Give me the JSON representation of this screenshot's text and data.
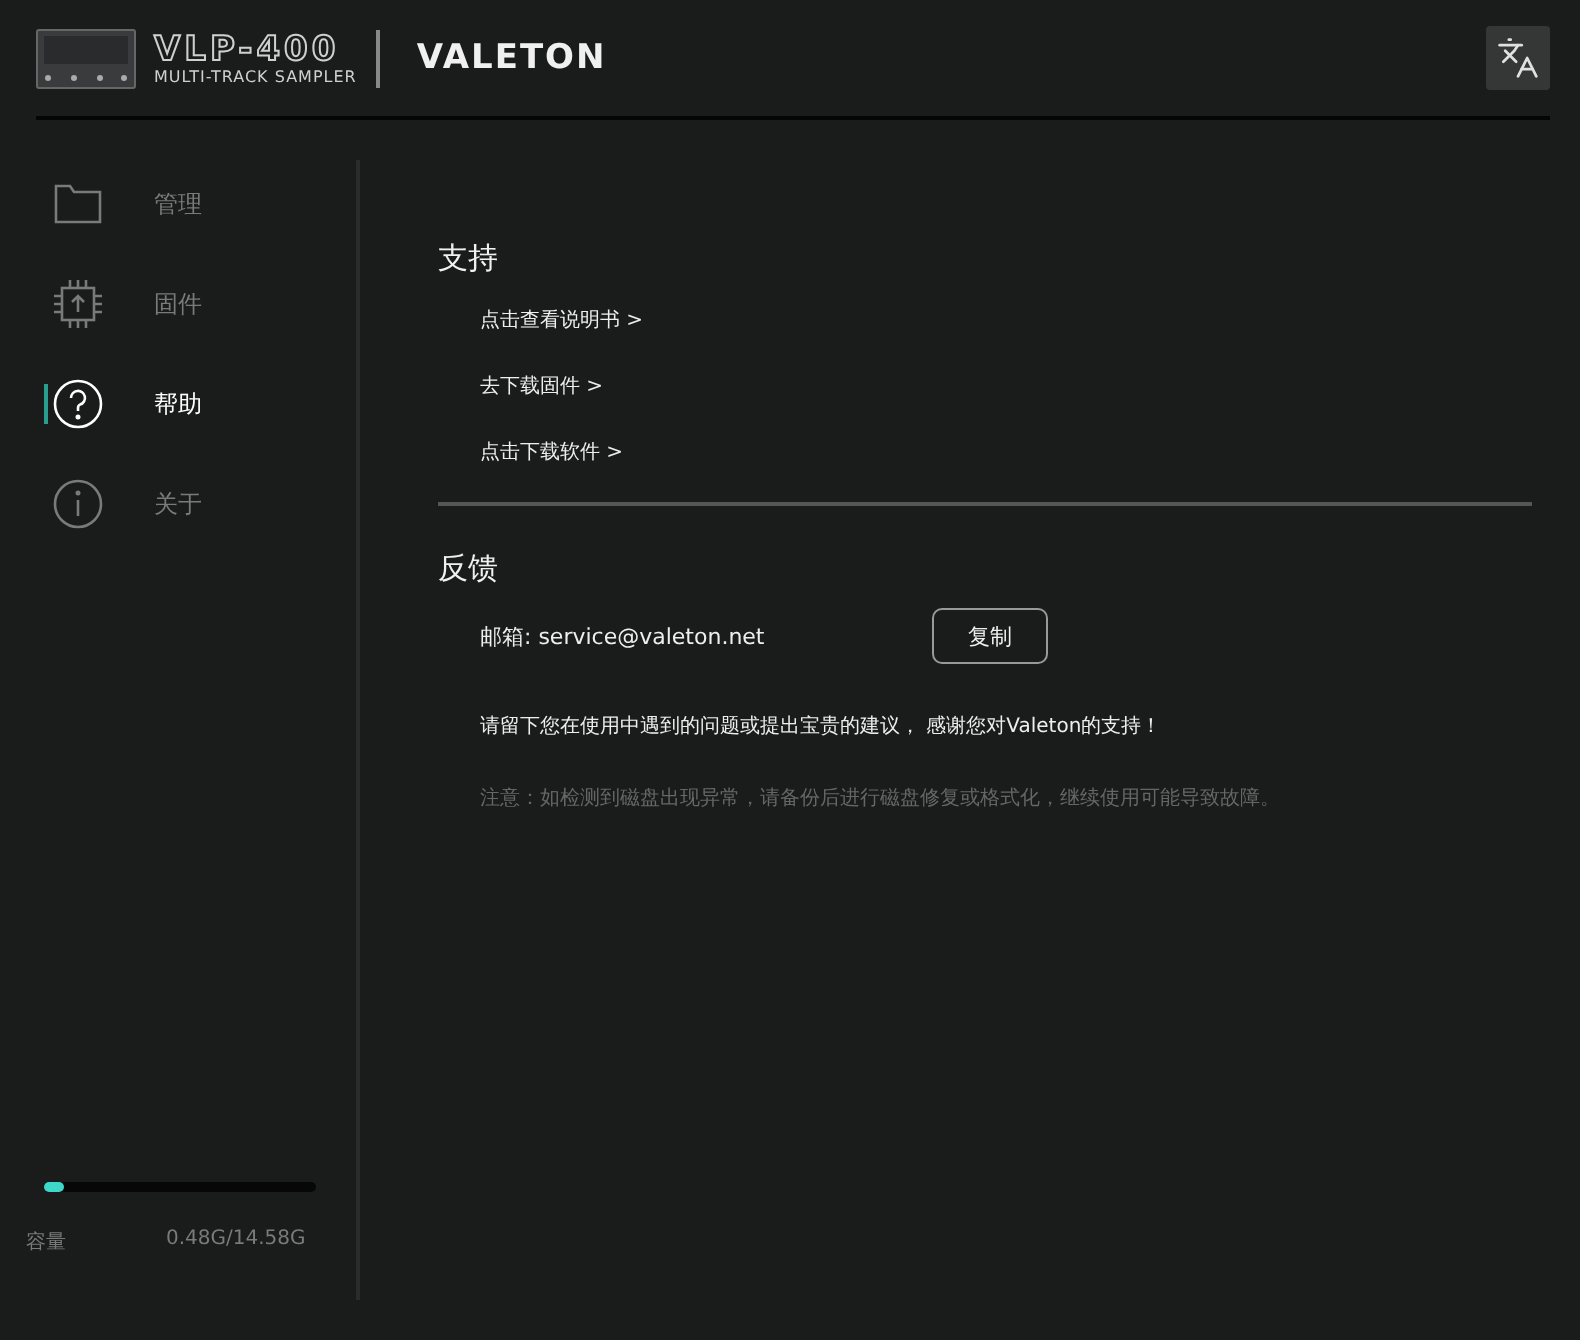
{
  "header": {
    "model": "VLP-400",
    "subtitle": "MULTI-TRACK SAMPLER",
    "brand": "VALETON"
  },
  "sidebar": {
    "items": [
      {
        "label": "管理",
        "kind": "folder",
        "selected": false
      },
      {
        "label": "固件",
        "kind": "chip",
        "selected": false
      },
      {
        "label": "帮助",
        "kind": "help",
        "selected": true
      },
      {
        "label": "关于",
        "kind": "info",
        "selected": false
      }
    ],
    "storage": {
      "label": "容量",
      "reading": "0.48G/14.58G",
      "level": 0.07
    }
  },
  "support": {
    "title": "支持",
    "links": [
      "点击查看说明书 >",
      "去下载固件 >",
      "点击下载软件 >"
    ]
  },
  "feedback": {
    "title": "反馈",
    "email": "邮箱: service@valeton.net",
    "copy_button": "复制",
    "message": "请留下您在使用中遇到的问题或提出宝贵的建议， 感谢您对Valeton的支持！",
    "note": "注意：如检测到磁盘出现异常，请备份后进行磁盘修复或格式化，继续使用可能导致故障。"
  }
}
